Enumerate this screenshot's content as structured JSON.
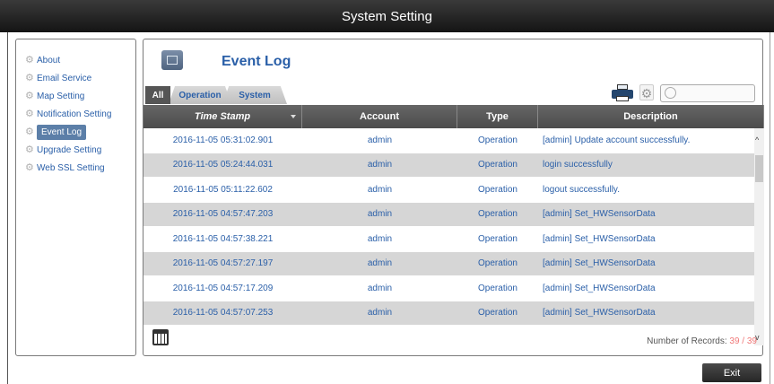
{
  "window": {
    "title": "System Setting"
  },
  "sidebar": {
    "items": [
      {
        "label": "About",
        "active": false
      },
      {
        "label": "Email Service",
        "active": false
      },
      {
        "label": "Map Setting",
        "active": false
      },
      {
        "label": "Notification Setting",
        "active": false
      },
      {
        "label": "Event Log",
        "active": true
      },
      {
        "label": "Upgrade Setting",
        "active": false
      },
      {
        "label": "Web SSL Setting",
        "active": false
      }
    ]
  },
  "panel": {
    "title": "Event Log"
  },
  "tabs": {
    "all": "All",
    "operation": "Operation",
    "system": "System"
  },
  "search": {
    "value": ""
  },
  "table": {
    "headers": {
      "timestamp": "Time Stamp",
      "account": "Account",
      "type": "Type",
      "description": "Description"
    },
    "rows": [
      {
        "timestamp": "2016-11-05 05:31:02.901",
        "account": "admin",
        "type": "Operation",
        "description": "[admin] Update account successfully."
      },
      {
        "timestamp": "2016-11-05 05:24:44.031",
        "account": "admin",
        "type": "Operation",
        "description": "login successfully"
      },
      {
        "timestamp": "2016-11-05 05:11:22.602",
        "account": "admin",
        "type": "Operation",
        "description": "logout successfully."
      },
      {
        "timestamp": "2016-11-05 04:57:47.203",
        "account": "admin",
        "type": "Operation",
        "description": "[admin] Set_HWSensorData"
      },
      {
        "timestamp": "2016-11-05 04:57:38.221",
        "account": "admin",
        "type": "Operation",
        "description": "[admin] Set_HWSensorData"
      },
      {
        "timestamp": "2016-11-05 04:57:27.197",
        "account": "admin",
        "type": "Operation",
        "description": "[admin] Set_HWSensorData"
      },
      {
        "timestamp": "2016-11-05 04:57:17.209",
        "account": "admin",
        "type": "Operation",
        "description": "[admin] Set_HWSensorData"
      },
      {
        "timestamp": "2016-11-05 04:57:07.253",
        "account": "admin",
        "type": "Operation",
        "description": "[admin] Set_HWSensorData"
      }
    ]
  },
  "footer": {
    "records_label": "Number of Records:",
    "records_count": "39 / 39"
  },
  "buttons": {
    "exit": "Exit"
  },
  "colors": {
    "link_blue": "#2a5fa8",
    "header_gray": "#555555",
    "row_alt": "#d6d6d6",
    "record_count": "#f07878"
  }
}
